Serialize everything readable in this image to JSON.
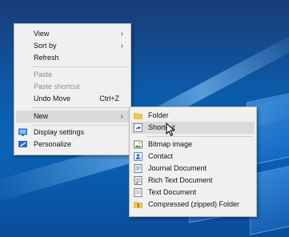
{
  "context_menu": {
    "view": "View",
    "sort_by": "Sort by",
    "refresh": "Refresh",
    "paste": "Paste",
    "paste_shortcut": "Paste shortcut",
    "undo_move": "Undo Move",
    "undo_move_shortcut": "Ctrl+Z",
    "new": "New",
    "display_settings": "Display settings",
    "personalize": "Personalize"
  },
  "new_submenu": {
    "folder": "Folder",
    "shortcut": "Shortcut",
    "bitmap_image": "Bitmap image",
    "contact": "Contact",
    "journal_document": "Journal Document",
    "rich_text_document": "Rich Text Document",
    "text_document": "Text Document",
    "compressed_folder": "Compressed (zipped) Folder"
  },
  "icons": {
    "folder": "folder-icon",
    "shortcut": "shortcut-icon",
    "bitmap": "bitmap-image-icon",
    "contact": "contact-icon",
    "journal": "journal-document-icon",
    "rich_text": "rich-text-document-icon",
    "text": "text-document-icon",
    "zip": "compressed-folder-icon",
    "display": "display-settings-icon",
    "personalize": "personalize-icon"
  },
  "colors": {
    "menu_background": "#f0f0f0",
    "hover_background": "#dadada",
    "disabled_text": "#8d8d8d",
    "desktop_blue": "#0a63b8"
  }
}
